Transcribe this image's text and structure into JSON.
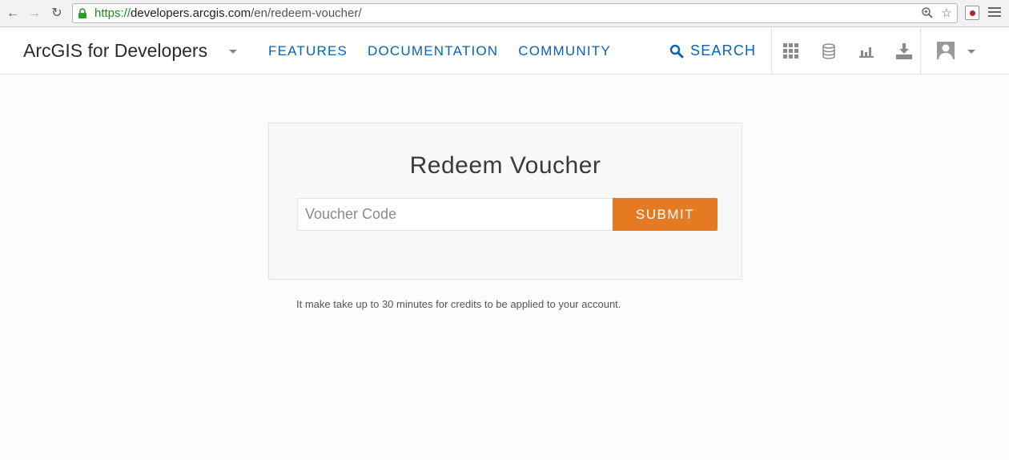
{
  "browser": {
    "url_scheme": "https://",
    "url_host": "developers.arcgis.com",
    "url_path": "/en/redeem-voucher/",
    "icons": [
      "back-arrow-icon",
      "forward-arrow-icon",
      "reload-icon",
      "lock-icon",
      "zoom-icon",
      "star-icon",
      "extension-icon",
      "menu-icon"
    ]
  },
  "header": {
    "brand": "ArcGIS for Developers",
    "nav": [
      "FEATURES",
      "DOCUMENTATION",
      "COMMUNITY"
    ],
    "search_label": "SEARCH",
    "icons": [
      "apps-grid-icon",
      "database-icon",
      "bar-chart-icon",
      "download-icon",
      "user-avatar-icon"
    ]
  },
  "card": {
    "title": "Redeem Voucher",
    "input_placeholder": "Voucher Code",
    "input_value": "",
    "submit_label": "SUBMIT"
  },
  "note": "It make take up to 30 minutes for credits to be applied to your account.",
  "colors": {
    "accent": "#e57a22",
    "link": "#0a63b0"
  }
}
